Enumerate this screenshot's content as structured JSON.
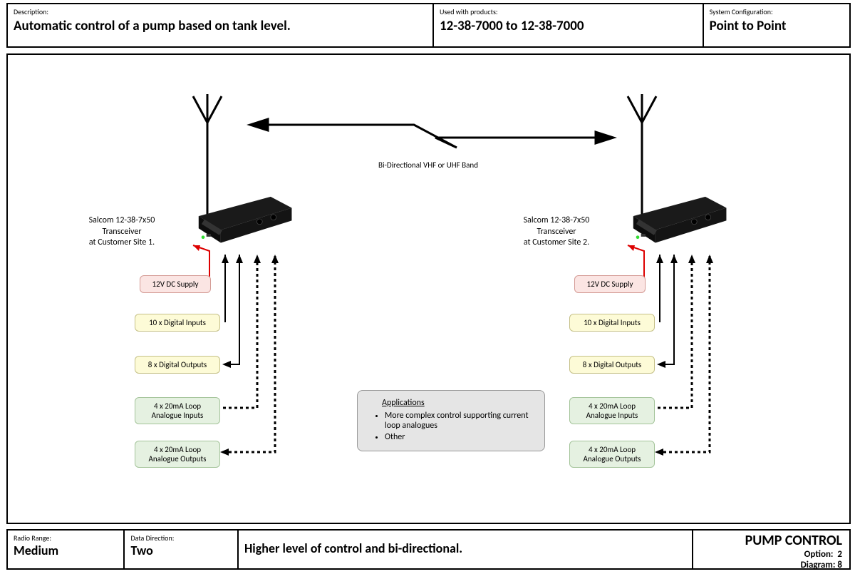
{
  "header": {
    "description_label": "Description:",
    "description_value": "Automatic control of a pump based on tank level.",
    "products_label": "Used with products:",
    "products_value": "12-38-7000 to 12-38-7000",
    "config_label": "System Configuration:",
    "config_value": "Point to Point"
  },
  "diagram": {
    "band_label": "Bi-Directional VHF or UHF Band",
    "site1_label_line1": "Salcom 12-38-7x50",
    "site1_label_line2": "Transceiver",
    "site1_label_line3": "at Customer Site 1.",
    "site2_label_line1": "Salcom 12-38-7x50",
    "site2_label_line2": "Transceiver",
    "site2_label_line3": "at Customer Site 2.",
    "tags": {
      "dc": "12V DC Supply",
      "di": "10 x Digital Inputs",
      "do": "8 x Digital Outputs",
      "ai_line1": "4 x 20mA Loop",
      "ai_line2": "Analogue Inputs",
      "ao_line1": "4 x 20mA Loop",
      "ao_line2": "Analogue Outputs"
    },
    "apps": {
      "title": "Applications",
      "item1": "More complex control supporting current loop analogues",
      "item2": "Other"
    }
  },
  "footer": {
    "range_label": "Radio Range:",
    "range_value": "Medium",
    "direction_label": "Data Direction:",
    "direction_value": "Two",
    "notes": "Higher level of control and bi-directional.",
    "title": "PUMP CONTROL",
    "option_label": "Option:",
    "option_value": "2",
    "diagram_label": "Diagram:",
    "diagram_value": "8"
  }
}
